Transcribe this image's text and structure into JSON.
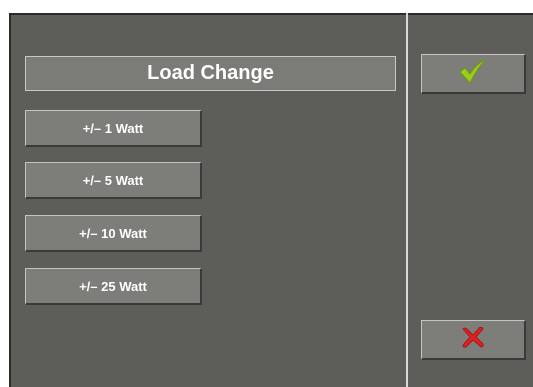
{
  "dialog": {
    "title": "Load Change"
  },
  "options": [
    {
      "label": "+/– 1 Watt"
    },
    {
      "label": "+/– 5 Watt"
    },
    {
      "label": "+/– 10 Watt"
    },
    {
      "label": "+/– 25 Watt"
    }
  ],
  "actions": {
    "confirm_icon": "checkmark-icon",
    "cancel_icon": "cross-icon"
  },
  "colors": {
    "background": "#5d5d5a",
    "button": "#7d7d7a",
    "confirm": "#9acd1e",
    "cancel": "#e02020"
  }
}
